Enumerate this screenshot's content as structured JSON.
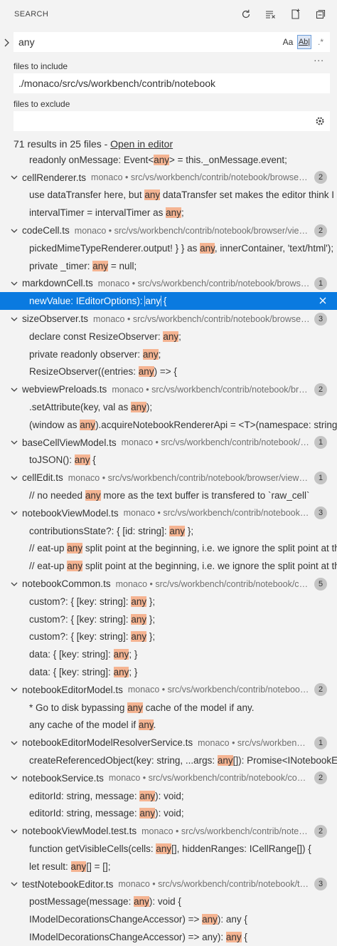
{
  "header": {
    "title": "SEARCH",
    "actions": [
      "refresh-icon",
      "clear-results-icon",
      "new-search-editor-icon",
      "collapse-all-icon"
    ]
  },
  "search": {
    "value": "any",
    "case_label": "Aa",
    "word_label": "Ab|",
    "regex_label": ".*"
  },
  "more_label": "...",
  "include": {
    "label": "files to include",
    "value": "./monaco/src/vs/workbench/contrib/notebook"
  },
  "exclude": {
    "label": "files to exclude",
    "value": ""
  },
  "summary": {
    "text": "71 results in 25 files - ",
    "link": "Open in editor"
  },
  "rows": [
    {
      "type": "match",
      "before": "readonly onMessage: Event<",
      "hit": "any",
      "after": "> = this._onMessage.event;"
    },
    {
      "type": "file",
      "name": "cellRenderer.ts",
      "path": "monaco • src/vs/workbench/contrib/notebook/browser/view/renderers",
      "count": "2"
    },
    {
      "type": "match",
      "before": "use dataTransfer here, but ",
      "hit": "any",
      "after": " dataTransfer set makes the editor think I am dragging a file"
    },
    {
      "type": "match",
      "before": "intervalTimer = intervalTimer as ",
      "hit": "any",
      "after": ";"
    },
    {
      "type": "file",
      "name": "codeCell.ts",
      "path": "monaco • src/vs/workbench/contrib/notebook/browser/view/renderers",
      "count": "2"
    },
    {
      "type": "match",
      "before": "pickedMimeTypeRenderer.output! } } as ",
      "hit": "any",
      "after": ", innerContainer, 'text/html');"
    },
    {
      "type": "match",
      "before": "private _timer: ",
      "hit": "any",
      "after": " = null;"
    },
    {
      "type": "file",
      "name": "markdownCell.ts",
      "path": "monaco • src/vs/workbench/contrib/notebook/browser/view/renderers",
      "count": "1"
    },
    {
      "type": "match",
      "selected": true,
      "before": "newValue: IEditorOptions): ",
      "hit": "any",
      "after": " {"
    },
    {
      "type": "file",
      "name": "sizeObserver.ts",
      "path": "monaco • src/vs/workbench/contrib/notebook/browser/view/renderers",
      "count": "3"
    },
    {
      "type": "match",
      "before": "declare const ResizeObserver: ",
      "hit": "any",
      "after": ";"
    },
    {
      "type": "match",
      "before": "private readonly observer: ",
      "hit": "any",
      "after": ";"
    },
    {
      "type": "match",
      "before": "ResizeObserver((entries: ",
      "hit": "any",
      "after": ") => {"
    },
    {
      "type": "file",
      "name": "webviewPreloads.ts",
      "path": "monaco • src/vs/workbench/contrib/notebook/browser/view/renderers",
      "count": "2"
    },
    {
      "type": "match",
      "before": ".setAttribute(key, val as ",
      "hit": "any",
      "after": ");"
    },
    {
      "type": "match",
      "before": "(window as ",
      "hit": "any",
      "after": ").acquireNotebookRendererApi = <T>(namespace: string) => {"
    },
    {
      "type": "file",
      "name": "baseCellViewModel.ts",
      "path": "monaco • src/vs/workbench/contrib/notebook/browser/viewModel",
      "count": "1"
    },
    {
      "type": "match",
      "before": "toJSON(): ",
      "hit": "any",
      "after": " {"
    },
    {
      "type": "file",
      "name": "cellEdit.ts",
      "path": "monaco • src/vs/workbench/contrib/notebook/browser/viewModel",
      "count": "1"
    },
    {
      "type": "match",
      "before": "// no needed ",
      "hit": "any",
      "after": " more as the text buffer is transfered to `raw_cell`"
    },
    {
      "type": "file",
      "name": "notebookViewModel.ts",
      "path": "monaco • src/vs/workbench/contrib/notebook/browser/viewModel",
      "count": "3"
    },
    {
      "type": "match",
      "before": "contributionsState?: { [id: string]: ",
      "hit": "any",
      "after": " };"
    },
    {
      "type": "match",
      "before": "// eat-up ",
      "hit": "any",
      "after": " split point at the beginning, i.e. we ignore the split point at the very beginning"
    },
    {
      "type": "match",
      "before": "// eat-up ",
      "hit": "any",
      "after": " split point at the beginning, i.e. we ignore the split point at the very beginning"
    },
    {
      "type": "file",
      "name": "notebookCommon.ts",
      "path": "monaco • src/vs/workbench/contrib/notebook/common",
      "count": "5"
    },
    {
      "type": "match",
      "before": "custom?: { [key: string]: ",
      "hit": "any",
      "after": " };"
    },
    {
      "type": "match",
      "before": "custom?: { [key: string]: ",
      "hit": "any",
      "after": " };"
    },
    {
      "type": "match",
      "before": "custom?: { [key: string]: ",
      "hit": "any",
      "after": " };"
    },
    {
      "type": "match",
      "before": "data: { [key: string]: ",
      "hit": "any",
      "after": "; }"
    },
    {
      "type": "match",
      "before": "data: { [key: string]: ",
      "hit": "any",
      "after": "; }"
    },
    {
      "type": "file",
      "name": "notebookEditorModel.ts",
      "path": "monaco • src/vs/workbench/contrib/notebook/common",
      "count": "2"
    },
    {
      "type": "match",
      "before": "* Go to disk bypassing ",
      "hit": "any",
      "after": " cache of the model if any."
    },
    {
      "type": "match",
      "before": "any cache of the model if ",
      "hit": "any",
      "after": "."
    },
    {
      "type": "file",
      "name": "notebookEditorModelResolverService.ts",
      "path": "monaco • src/vs/workbench/contrib/notebook/common",
      "count": "1"
    },
    {
      "type": "match",
      "before": "createReferencedObject(key: string, ...args: ",
      "hit": "any",
      "after": "[]): Promise<INotebookEditorModel> {"
    },
    {
      "type": "file",
      "name": "notebookService.ts",
      "path": "monaco • src/vs/workbench/contrib/notebook/common",
      "count": "2"
    },
    {
      "type": "match",
      "before": "editorId: string, message: ",
      "hit": "any",
      "after": "): void;"
    },
    {
      "type": "match",
      "before": "editorId: string, message: ",
      "hit": "any",
      "after": "): void;"
    },
    {
      "type": "file",
      "name": "notebookViewModel.test.ts",
      "path": "monaco • src/vs/workbench/contrib/notebook/test",
      "count": "2"
    },
    {
      "type": "match",
      "before": "function getVisibleCells(cells: ",
      "hit": "any",
      "after": "[], hiddenRanges: ICellRange[]) {"
    },
    {
      "type": "match",
      "before": "let result: ",
      "hit": "any",
      "after": "[] = [];"
    },
    {
      "type": "file",
      "name": "testNotebookEditor.ts",
      "path": "monaco • src/vs/workbench/contrib/notebook/test",
      "count": "3"
    },
    {
      "type": "match",
      "before": "postMessage(message: ",
      "hit": "any",
      "after": "): void {"
    },
    {
      "type": "match",
      "before": "IModelDecorationsChangeAccessor) => ",
      "hit": "any",
      "after": "): any {"
    },
    {
      "type": "match",
      "before": "IModelDecorationsChangeAccessor) => any): ",
      "hit": "any",
      "after": " {"
    }
  ]
}
